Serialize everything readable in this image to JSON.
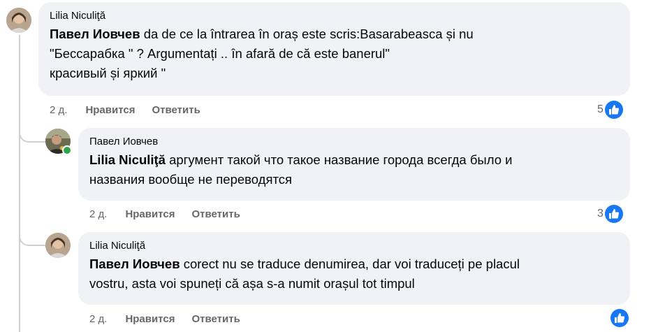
{
  "comments": [
    {
      "author": "Lilia Niculiţă",
      "mention": "Павел Иовчев",
      "text": " da de ce la întrarea în oraș este scris:Basarabeasca și nu\n\"Бессарабка \" ? Argumentați .. în afară de că este banerul\"\nкрасивый și яркий \"",
      "time": "2 д.",
      "like_label": "Нравится",
      "reply_label": "Ответить",
      "reaction_count": "5"
    },
    {
      "author": "Павел Иовчев",
      "mention": "Lilia Niculiţă",
      "text": " аргумент такой что такое название города всегда было и\nназвания вообще не переводятся",
      "time": "2 д.",
      "like_label": "Нравится",
      "reply_label": "Ответить",
      "reaction_count": "3"
    },
    {
      "author": "Lilia Niculiţă",
      "mention": "Павел Иовчев",
      "text": " corect nu se traduce denumirea, dar voi traduceți pe placul\nvostru, asta voi spuneți că așa s-a numit orașul tot timpul",
      "time": "2 д.",
      "like_label": "Нравится",
      "reply_label": "Ответить",
      "reaction_count": ""
    }
  ],
  "colors": {
    "bubble": "#f0f2f5",
    "like_blue": "#1877f2",
    "meta_gray": "#65676b",
    "online_green": "#31a24c"
  }
}
